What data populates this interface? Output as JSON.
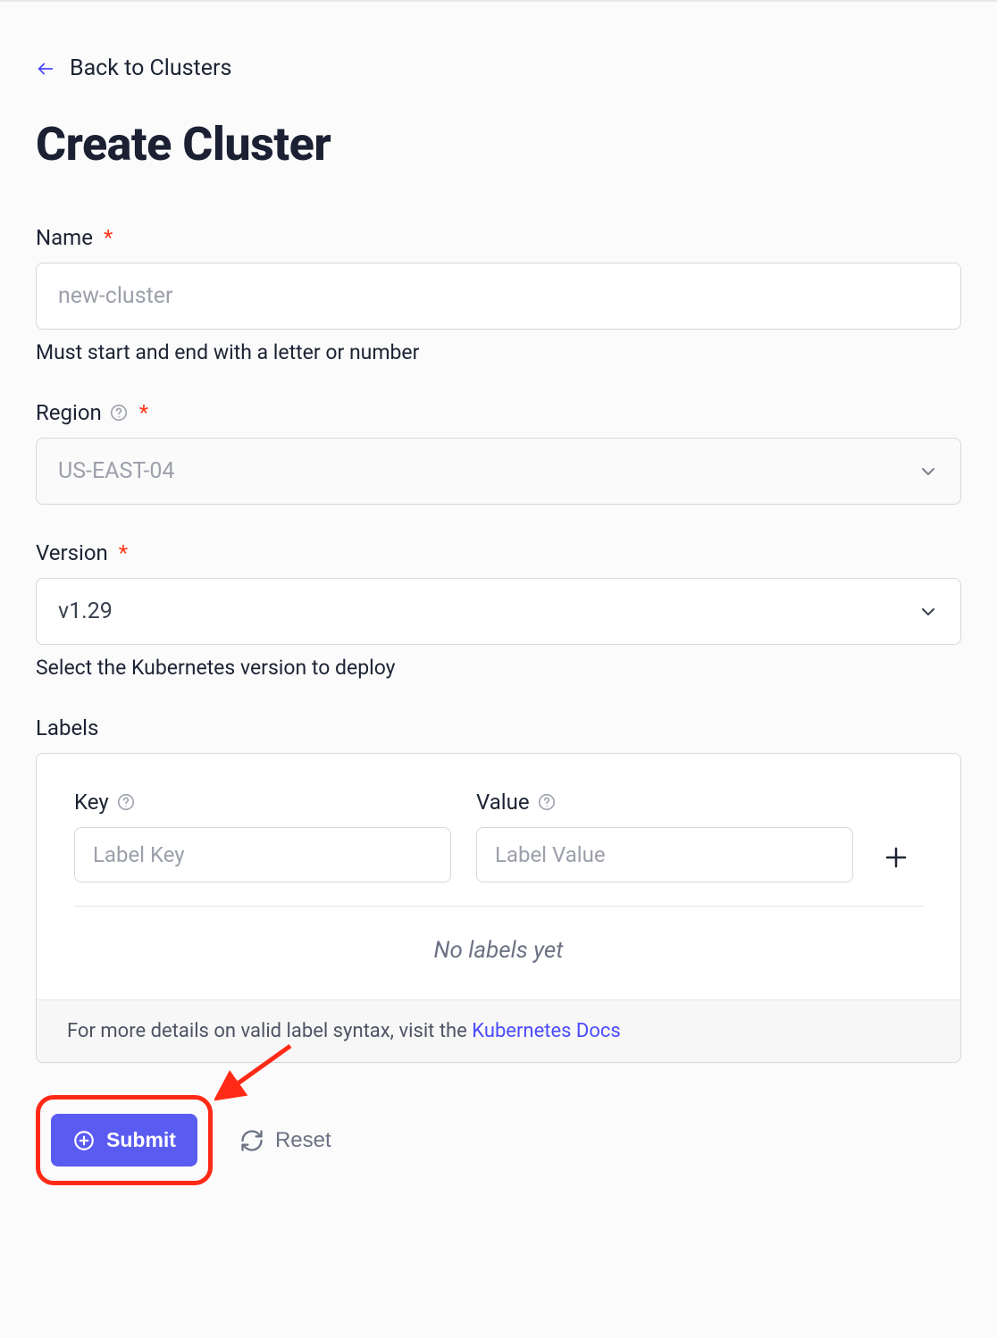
{
  "nav": {
    "back_label": "Back to Clusters"
  },
  "page": {
    "title": "Create Cluster"
  },
  "form": {
    "name": {
      "label": "Name",
      "placeholder": "new-cluster",
      "hint": "Must start and end with a letter or number"
    },
    "region": {
      "label": "Region",
      "placeholder": "US-EAST-04"
    },
    "version": {
      "label": "Version",
      "value": "v1.29",
      "hint": "Select the Kubernetes version to deploy"
    },
    "labels": {
      "label": "Labels",
      "key_label": "Key",
      "key_placeholder": "Label Key",
      "value_label": "Value",
      "value_placeholder": "Label Value",
      "empty_text": "No labels yet",
      "footer_text": "For more details on valid label syntax, visit the ",
      "footer_link_text": "Kubernetes Docs"
    }
  },
  "actions": {
    "submit_label": "Submit",
    "reset_label": "Reset"
  }
}
